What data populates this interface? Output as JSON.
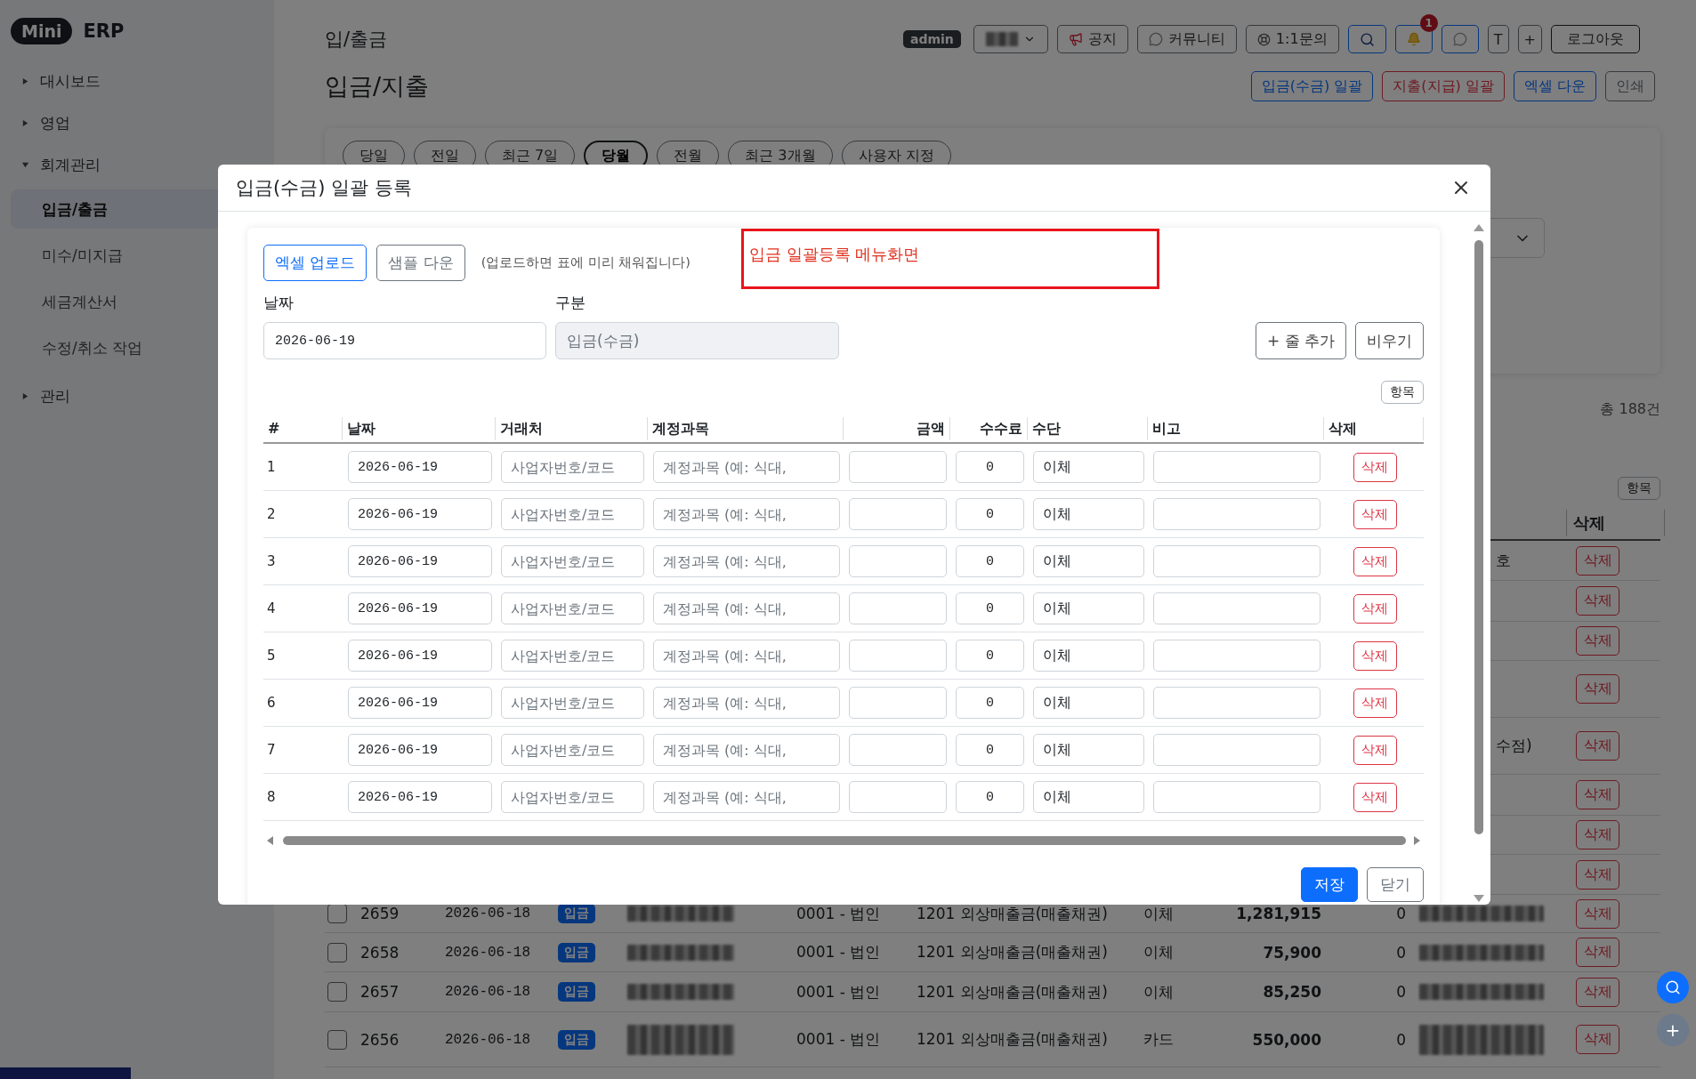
{
  "sidebar": {
    "logo_badge": "Mini",
    "logo_text": "ERP",
    "items": [
      {
        "label": "대시보드",
        "expanded": false
      },
      {
        "label": "영업",
        "expanded": false
      },
      {
        "label": "회계관리",
        "expanded": true,
        "children": [
          {
            "label": "입금/출금",
            "selected": true
          },
          {
            "label": "미수/미지급",
            "selected": false
          },
          {
            "label": "세금계산서",
            "selected": false
          },
          {
            "label": "수정/취소 작업",
            "selected": false
          }
        ]
      },
      {
        "label": "관리",
        "expanded": false
      }
    ]
  },
  "header": {
    "breadcrumb": "입/출금",
    "title": "입금/지출",
    "user_menu": [
      {
        "kind": "badge",
        "label": "admin"
      },
      {
        "kind": "account"
      },
      {
        "kind": "notice",
        "label": "공지"
      },
      {
        "kind": "community",
        "label": "커뮤니티"
      },
      {
        "kind": "inquiry",
        "label": "1:1문의"
      },
      {
        "kind": "search"
      },
      {
        "kind": "notifications",
        "count": "1"
      },
      {
        "kind": "messages"
      },
      {
        "kind": "text",
        "label": "T"
      },
      {
        "kind": "text",
        "label": "+"
      },
      {
        "kind": "logout",
        "label": "로그아웃"
      }
    ],
    "actions": [
      {
        "label": "입금(수금) 일괄",
        "kind": "primary"
      },
      {
        "label": "지출(지급) 일괄",
        "kind": "danger"
      },
      {
        "label": "엑셀 다운",
        "kind": "primary"
      },
      {
        "label": "인쇄",
        "kind": "secondary"
      }
    ]
  },
  "filters": {
    "periods": [
      {
        "label": "당일",
        "selected": false
      },
      {
        "label": "전일",
        "selected": false
      },
      {
        "label": "최근 7일",
        "selected": false
      },
      {
        "label": "당월",
        "selected": true
      },
      {
        "label": "전월",
        "selected": false
      },
      {
        "label": "최근 3개월",
        "selected": false
      },
      {
        "label": "사용자 지정",
        "selected": false
      }
    ]
  },
  "list": {
    "total": "총 188건",
    "columns_button": "항목",
    "delete_header": "삭제",
    "rows": [
      {
        "remark": "호",
        "delete": "삭제"
      },
      {
        "delete": "삭제"
      },
      {
        "delete": "삭제"
      },
      {
        "delete": "삭제"
      },
      {
        "remark": "수점)",
        "delete": "삭제"
      },
      {
        "delete": "삭제"
      },
      {
        "delete": "삭제"
      },
      {
        "delete": "삭제"
      },
      {
        "checked": false,
        "id": "2659",
        "date": "2026-06-18",
        "type": "입금",
        "client_redacted": true,
        "business": "0001 - 법인",
        "account": "1201 외상매출금(매출채권)",
        "method": "이체",
        "amount": "1,281,915",
        "fee": "0",
        "remark_redacted": true,
        "delete": "삭제"
      },
      {
        "checked": false,
        "id": "2658",
        "date": "2026-06-18",
        "type": "입금",
        "client_redacted": true,
        "business": "0001 - 법인",
        "account": "1201 외상매출금(매출채권)",
        "method": "이체",
        "amount": "75,900",
        "fee": "0",
        "remark_redacted": true,
        "delete": "삭제"
      },
      {
        "checked": false,
        "id": "2657",
        "date": "2026-06-18",
        "type": "입금",
        "client_redacted": true,
        "business": "0001 - 법인",
        "account": "1201 외상매출금(매출채권)",
        "method": "이체",
        "amount": "85,250",
        "fee": "0",
        "remark_redacted": true,
        "delete": "삭제"
      },
      {
        "checked": false,
        "id": "2656",
        "date": "2026-06-18",
        "type": "입금",
        "client_redacted": true,
        "business": "0001 - 법인",
        "account": "1201 외상매출금(매출채권)",
        "method": "카드",
        "amount": "550,000",
        "fee": "0",
        "remark_redacted": true,
        "delete": "삭제"
      }
    ]
  },
  "modal": {
    "title": "입금(수금) 일괄 등록",
    "toolbar": [
      {
        "label": "엑셀 업로드",
        "color": "#0d6efd"
      },
      {
        "label": "샘플 다운",
        "color": "#6c757d"
      }
    ],
    "hint": "(업로드하면 표에 미리 채워집니다)",
    "annotation": "입금 일괄등록 메뉴화면",
    "fields": [
      {
        "label": "날짜",
        "value": "2026-06-19",
        "disabled": false
      },
      {
        "label": "구분",
        "value": "입금(수금)",
        "disabled": true
      }
    ],
    "row_buttons": [
      "+ 줄 추가",
      "비우기"
    ],
    "columns_button": "항목",
    "columns": [
      "#",
      "날짜",
      "거래처",
      "계정과목",
      "금액",
      "수수료",
      "수단",
      "비고",
      "삭제"
    ],
    "rows": [
      {
        "number": "1",
        "date": "2026-06-19",
        "client_placeholder": "사업자번호/코드",
        "account_placeholder": "계정과목 (예: 식대,",
        "fee": "0",
        "method": "이체",
        "delete": "삭제"
      },
      {
        "number": "2",
        "date": "2026-06-19",
        "client_placeholder": "사업자번호/코드",
        "account_placeholder": "계정과목 (예: 식대,",
        "fee": "0",
        "method": "이체",
        "delete": "삭제"
      },
      {
        "number": "3",
        "date": "2026-06-19",
        "client_placeholder": "사업자번호/코드",
        "account_placeholder": "계정과목 (예: 식대,",
        "fee": "0",
        "method": "이체",
        "delete": "삭제"
      },
      {
        "number": "4",
        "date": "2026-06-19",
        "client_placeholder": "사업자번호/코드",
        "account_placeholder": "계정과목 (예: 식대,",
        "fee": "0",
        "method": "이체",
        "delete": "삭제"
      },
      {
        "number": "5",
        "date": "2026-06-19",
        "client_placeholder": "사업자번호/코드",
        "account_placeholder": "계정과목 (예: 식대,",
        "fee": "0",
        "method": "이체",
        "delete": "삭제"
      },
      {
        "number": "6",
        "date": "2026-06-19",
        "client_placeholder": "사업자번호/코드",
        "account_placeholder": "계정과목 (예: 식대,",
        "fee": "0",
        "method": "이체",
        "delete": "삭제"
      },
      {
        "number": "7",
        "date": "2026-06-19",
        "client_placeholder": "사업자번호/코드",
        "account_placeholder": "계정과목 (예: 식대,",
        "fee": "0",
        "method": "이체",
        "delete": "삭제"
      },
      {
        "number": "8",
        "date": "2026-06-19",
        "client_placeholder": "사업자번호/코드",
        "account_placeholder": "계정과목 (예: 식대,",
        "fee": "0",
        "method": "이체",
        "delete": "삭제"
      }
    ],
    "footer": [
      {
        "label": "저장",
        "primary": true
      },
      {
        "label": "닫기",
        "primary": false
      }
    ]
  },
  "floating_buttons": [
    {
      "kind": "search"
    },
    {
      "kind": "add",
      "label": "+"
    }
  ]
}
